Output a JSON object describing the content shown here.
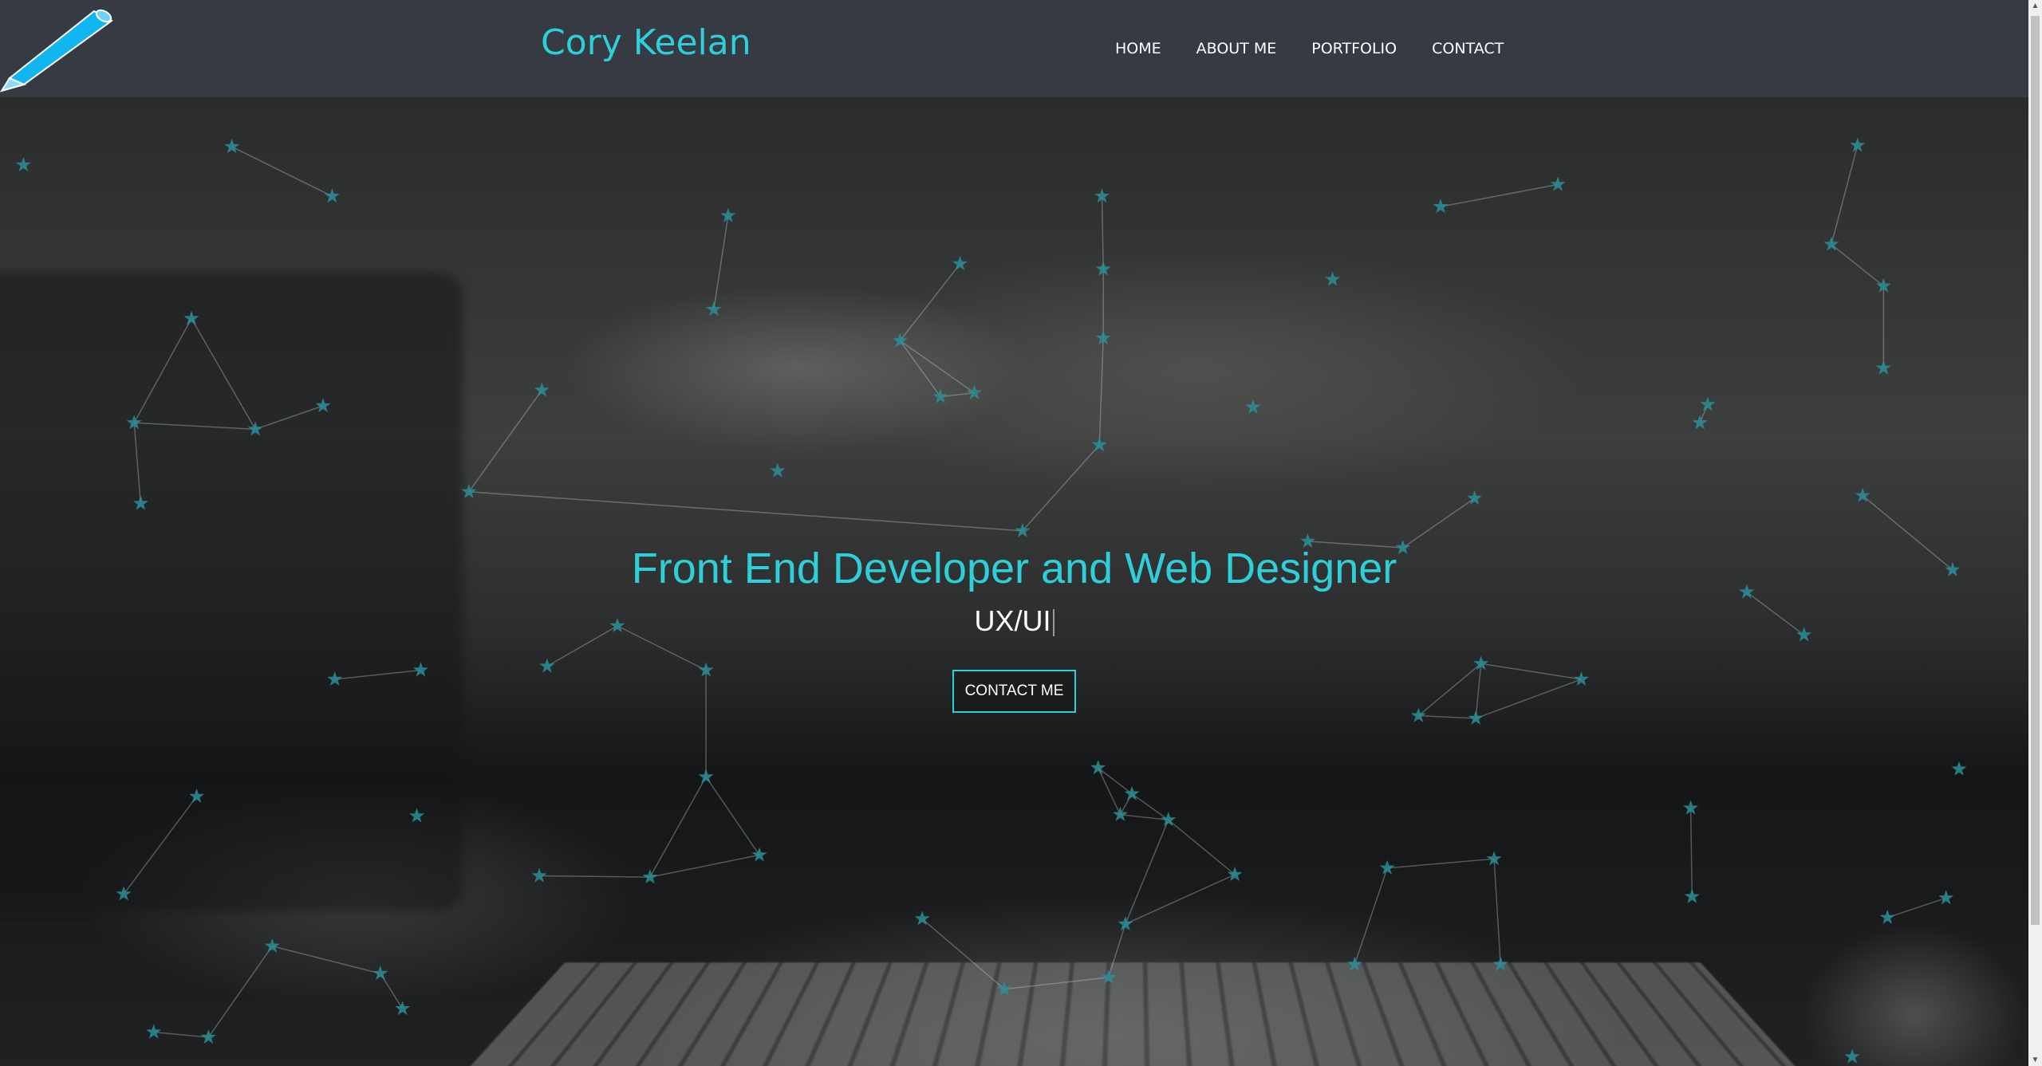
{
  "header": {
    "brand": "Cory Keelan",
    "nav": [
      "HOME",
      "ABOUT ME",
      "PORTFOLIO",
      "CONTACT"
    ]
  },
  "hero": {
    "headline": "Front End Developer and Web Designer",
    "typed_text": "UX/UI",
    "cta_label": "CONTACT ME"
  },
  "colors": {
    "accent": "#2ecfd9",
    "header_bg": "#363a42"
  },
  "icons": {
    "logo": "pencil-icon"
  }
}
